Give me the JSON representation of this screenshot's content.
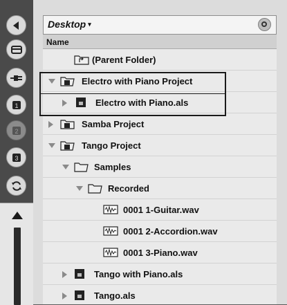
{
  "header": {
    "location": "Desktop",
    "location_caret": "▾"
  },
  "columns": {
    "name": "Name"
  },
  "sidebar": {
    "buttons": [
      {
        "icon": "back-arrow-icon",
        "active": true
      },
      {
        "icon": "devices-icon",
        "active": true
      },
      {
        "icon": "plugin-icon",
        "active": true
      },
      {
        "icon": "disk-1-icon",
        "active": true
      },
      {
        "icon": "disk-2-icon",
        "active": false
      },
      {
        "icon": "disk-3-icon",
        "active": true
      },
      {
        "icon": "refresh-icon",
        "active": true
      }
    ]
  },
  "rows": [
    {
      "label": "(Parent Folder)",
      "type": "parent-folder"
    },
    {
      "label": "Electro with Piano Project",
      "type": "project",
      "expanded": true
    },
    {
      "label": "Electro with Piano.als",
      "type": "live-set"
    },
    {
      "label": "Samba Project",
      "type": "project",
      "expanded": false
    },
    {
      "label": "Tango Project",
      "type": "project",
      "expanded": true
    },
    {
      "label": "Samples",
      "type": "folder",
      "expanded": true
    },
    {
      "label": "Recorded",
      "type": "folder",
      "expanded": true
    },
    {
      "label": "0001 1-Guitar.wav",
      "type": "audio"
    },
    {
      "label": "0001 2-Accordion.wav",
      "type": "audio"
    },
    {
      "label": "0001 3-Piano.wav",
      "type": "audio"
    },
    {
      "label": "Tango with Piano.als",
      "type": "live-set"
    },
    {
      "label": "Tango.als",
      "type": "live-set"
    }
  ],
  "colors": {
    "accent_dark": "#1a1a1a",
    "row_bg": "#eaeaea",
    "sidebar_bg": "#4a4a4a"
  }
}
